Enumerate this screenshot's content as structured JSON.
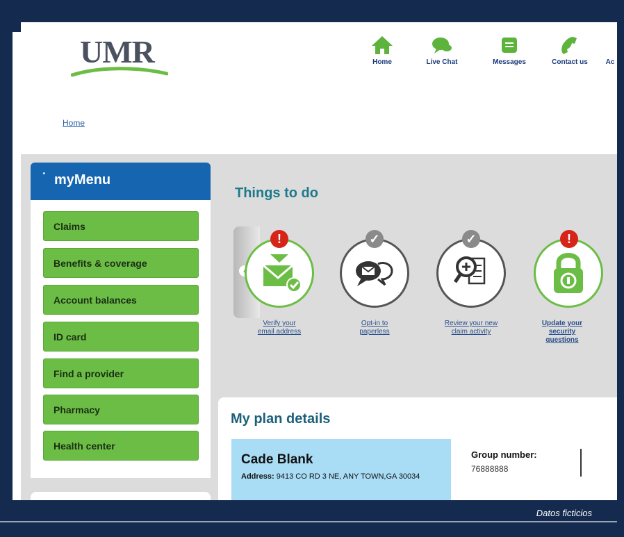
{
  "brand": {
    "logo_text": "UMR",
    "accent_green": "#6cbd45",
    "menu_blue": "#1565b0",
    "frame_navy": "#142a4e"
  },
  "topnav": [
    {
      "label": "Home",
      "icon": "home-icon"
    },
    {
      "label": "Live Chat",
      "icon": "chat-icon"
    },
    {
      "label": "Messages",
      "icon": "messages-icon"
    },
    {
      "label": "Contact us",
      "icon": "phone-icon"
    },
    {
      "label": "Ac",
      "icon": ""
    }
  ],
  "breadcrumb": {
    "home": "Home"
  },
  "menu": {
    "title": "myMenu",
    "items": [
      "Claims",
      "Benefits & coverage",
      "Account balances",
      "ID card",
      "Find a provider",
      "Pharmacy",
      "Health center"
    ]
  },
  "things_to_do": {
    "title": "Things to do",
    "items": [
      {
        "line1": "Verify your",
        "line2": "email address",
        "line3": "",
        "status": "alert",
        "icon": "email-check-icon"
      },
      {
        "line1": "Opt-in to",
        "line2": "paperless",
        "line3": "",
        "status": "done",
        "icon": "chat-bubbles-icon"
      },
      {
        "line1": "Review your new",
        "line2": "claim activity",
        "line3": "",
        "status": "done",
        "icon": "document-search-icon"
      },
      {
        "line1": "Update your",
        "line2": "security",
        "line3": "questions",
        "status": "alert",
        "icon": "padlock-icon"
      }
    ]
  },
  "plan": {
    "title": "My plan details",
    "member_name": "Cade Blank",
    "address_label": "Address:",
    "address_value": "9413 CO RD 3 NE, ANY TOWN,GA 30034",
    "group_label": "Group number:",
    "group_value": "76888888"
  },
  "footer": {
    "note": "Datos ficticios"
  }
}
